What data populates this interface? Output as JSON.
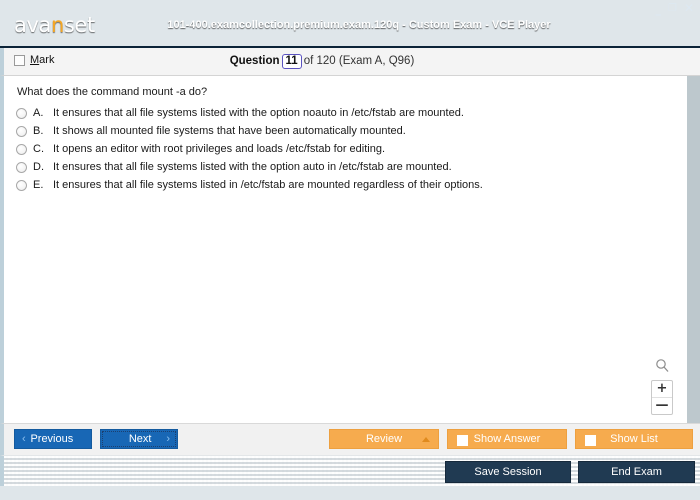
{
  "window": {
    "logo_text_a": "ava",
    "logo_text_n": "n",
    "logo_text_b": "set",
    "title": "101-400.examcollection.premium.exam.120q - Custom Exam - VCE Player",
    "minimize": "_",
    "maximize": "❐",
    "close": "✕"
  },
  "question_bar": {
    "mark_label_underlined": "M",
    "mark_label_rest": "ark",
    "question_word": "Question",
    "question_number": "11",
    "of_text": "of 120 (Exam A, Q96)"
  },
  "question": {
    "prompt": "What does the command mount -a do?",
    "options": [
      {
        "letter": "A.",
        "text": "It ensures that all file systems listed with the option noauto in /etc/fstab are mounted."
      },
      {
        "letter": "B.",
        "text": "It shows all mounted file systems that have been automatically mounted."
      },
      {
        "letter": "C.",
        "text": "It opens an editor with root privileges and loads /etc/fstab for editing."
      },
      {
        "letter": "D.",
        "text": "It ensures that all file systems listed with the option auto in /etc/fstab are mounted."
      },
      {
        "letter": "E.",
        "text": "It ensures that all file systems listed in /etc/fstab are mounted regardless of their options."
      }
    ]
  },
  "zoom_controls": {
    "zoom_in": "+",
    "zoom_out": "—"
  },
  "toolbar": {
    "previous_label": "Previous",
    "previous_chevron": "‹",
    "next_label": "Next",
    "next_chevron": "›",
    "review_label": "Review",
    "show_answer_label": "Show Answer",
    "show_list_label": "Show List"
  },
  "statusbar": {
    "save_session_label": "Save Session",
    "end_exam_label": "End Exam"
  },
  "colors": {
    "titlebar_dark": "#0f2d48",
    "titlebar_light": "#2a577e",
    "accent_orange": "#f5a623",
    "button_blue": "#1867b5",
    "button_orange": "#f6ab4e",
    "status_button": "#203a52"
  }
}
